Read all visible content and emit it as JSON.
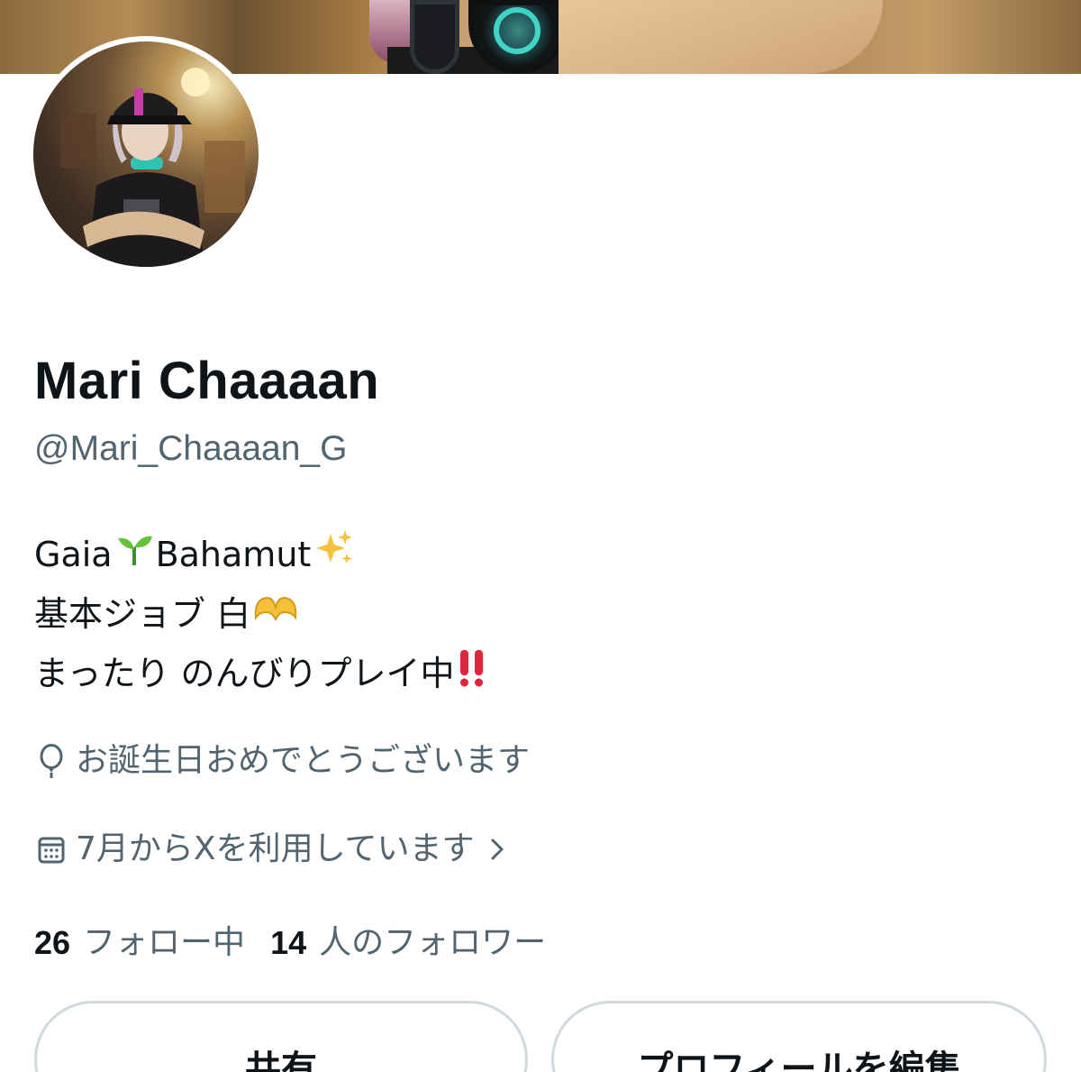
{
  "profile": {
    "display_name": "Mari Chaaaan",
    "handle": "@Mari_Chaaaan_G",
    "bio": {
      "line1_a": "Gaia",
      "line1_emoji": "seedling",
      "line1_b": "Bahamut",
      "line1_emoji2": "sparkles",
      "line2": "基本ジョブ 白",
      "line2_emoji": "heart-hands",
      "line3": "まったり のんびりプレイ中",
      "line3_emoji": "double-exclamation"
    },
    "birthday_text": "お誕生日おめでとうございます",
    "joined_text": "7月からXを利用しています",
    "following_count": "26",
    "following_label": "フォロー中",
    "followers_count": "14",
    "followers_label": "人のフォロワー"
  },
  "actions": {
    "share_label": "共有",
    "edit_label": "プロフィールを編集"
  },
  "icons": {
    "birthday": "balloon-icon",
    "joined": "calendar-icon",
    "chevron": "chevron-right-icon"
  },
  "colors": {
    "text_primary": "#0f1419",
    "text_secondary": "#536471",
    "button_border": "#cfd9de"
  }
}
